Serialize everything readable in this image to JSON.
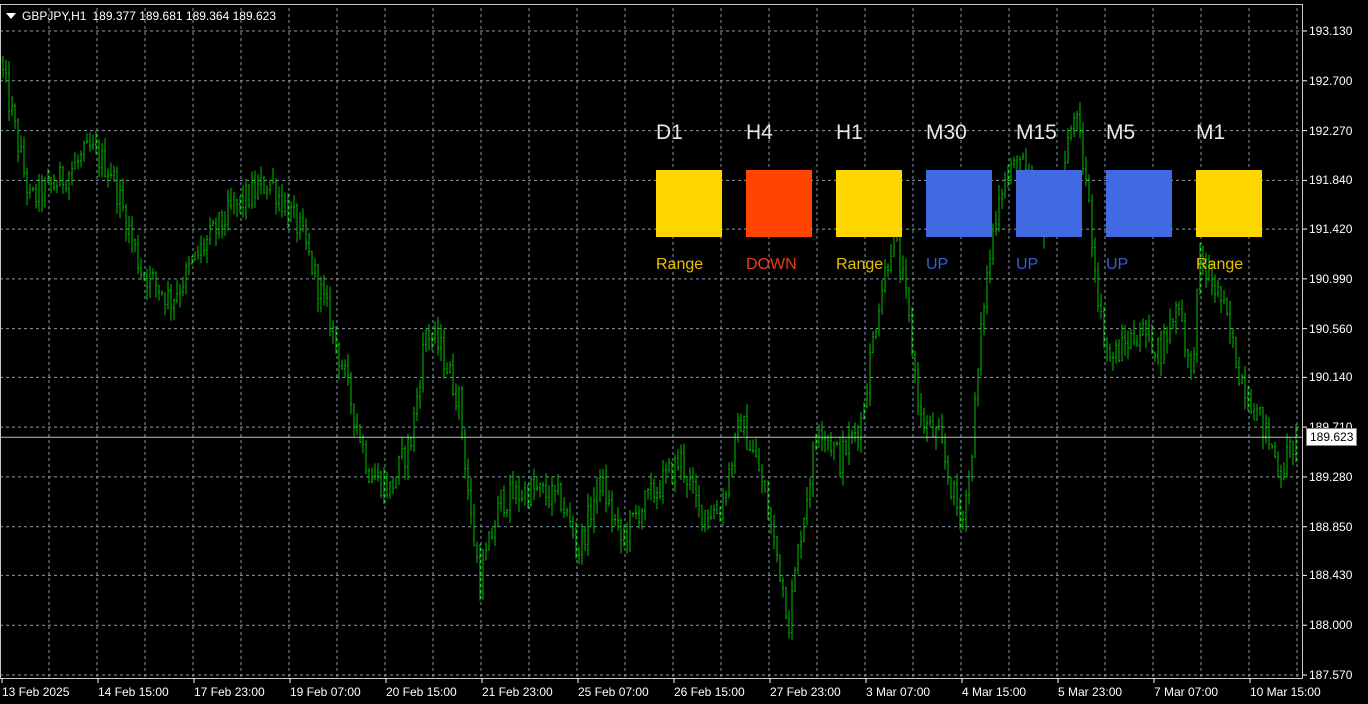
{
  "header": {
    "symbol": "GBPJPY,H1",
    "ohlc": "189.377 189.681 189.364 189.623"
  },
  "chart_data": {
    "type": "ohlc",
    "title": "GBPJPY,H1",
    "bar_color": "#00c000",
    "ylim": [
      187.57,
      193.13
    ],
    "y_ticks": [
      "193.130",
      "192.700",
      "192.270",
      "191.840",
      "191.420",
      "190.990",
      "190.560",
      "190.140",
      "189.710",
      "189.280",
      "188.850",
      "188.430",
      "188.000",
      "187.570"
    ],
    "x_ticks": [
      "13 Feb 2025",
      "14 Feb 15:00",
      "17 Feb 23:00",
      "19 Feb 07:00",
      "20 Feb 15:00",
      "21 Feb 23:00",
      "25 Feb 07:00",
      "26 Feb 15:00",
      "27 Feb 23:00",
      "3 Mar 07:00",
      "4 Mar 15:00",
      "5 Mar 23:00",
      "7 Mar 07:00",
      "10 Mar 15:00"
    ],
    "bars_per_tick": 32,
    "total_bars": 432,
    "current_price": "189.623",
    "close_path": [
      [
        0,
        192.88
      ],
      [
        5,
        192.28
      ],
      [
        10,
        191.67
      ],
      [
        20,
        191.84
      ],
      [
        30,
        192.1
      ],
      [
        37,
        191.93
      ],
      [
        47,
        191.07
      ],
      [
        57,
        190.81
      ],
      [
        67,
        191.24
      ],
      [
        77,
        191.58
      ],
      [
        90,
        191.84
      ],
      [
        100,
        191.41
      ],
      [
        110,
        190.63
      ],
      [
        117,
        189.94
      ],
      [
        123,
        189.34
      ],
      [
        130,
        189.17
      ],
      [
        137,
        189.6
      ],
      [
        142,
        190.55
      ],
      [
        147,
        190.38
      ],
      [
        153,
        189.94
      ],
      [
        157,
        188.91
      ],
      [
        160,
        188.39
      ],
      [
        167,
        189.08
      ],
      [
        177,
        189.17
      ],
      [
        187,
        189.08
      ],
      [
        193,
        188.65
      ],
      [
        200,
        189.25
      ],
      [
        207,
        188.73
      ],
      [
        213,
        188.99
      ],
      [
        227,
        189.43
      ],
      [
        233,
        188.99
      ],
      [
        240,
        188.99
      ],
      [
        247,
        189.77
      ],
      [
        253,
        189.34
      ],
      [
        260,
        188.48
      ],
      [
        263,
        188.04
      ],
      [
        267,
        188.82
      ],
      [
        273,
        189.77
      ],
      [
        280,
        189.43
      ],
      [
        287,
        189.77
      ],
      [
        293,
        190.81
      ],
      [
        298,
        191.41
      ],
      [
        302,
        190.81
      ],
      [
        307,
        189.77
      ],
      [
        313,
        189.6
      ],
      [
        320,
        188.91
      ],
      [
        323,
        189.25
      ],
      [
        328,
        190.81
      ],
      [
        333,
        191.76
      ],
      [
        340,
        192.02
      ],
      [
        347,
        191.41
      ],
      [
        353,
        191.67
      ],
      [
        358,
        192.45
      ],
      [
        362,
        191.84
      ],
      [
        367,
        190.63
      ],
      [
        370,
        190.29
      ],
      [
        380,
        190.55
      ],
      [
        387,
        190.38
      ],
      [
        393,
        190.81
      ],
      [
        397,
        190.12
      ],
      [
        400,
        191.15
      ],
      [
        407,
        190.81
      ],
      [
        413,
        190.2
      ],
      [
        420,
        189.77
      ],
      [
        427,
        189.34
      ],
      [
        432,
        189.62
      ]
    ]
  },
  "dashboard": [
    {
      "tf": "D1",
      "status": "Range",
      "color": "#ffd700"
    },
    {
      "tf": "H4",
      "status": "DOWN",
      "color": "#ff4500"
    },
    {
      "tf": "H1",
      "status": "Range",
      "color": "#ffd700"
    },
    {
      "tf": "M30",
      "status": "UP",
      "color": "#4169e1"
    },
    {
      "tf": "M15",
      "status": "UP",
      "color": "#4169e1"
    },
    {
      "tf": "M5",
      "status": "UP",
      "color": "#4169e1"
    },
    {
      "tf": "M1",
      "status": "Range",
      "color": "#ffd700"
    }
  ]
}
